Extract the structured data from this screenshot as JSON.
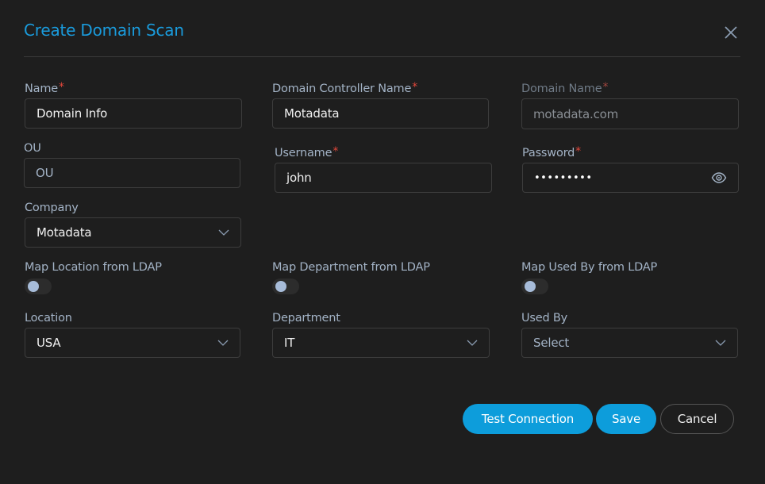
{
  "dialog": {
    "title": "Create Domain Scan",
    "close_icon": "close-icon"
  },
  "fields": {
    "name": {
      "label": "Name",
      "required": "*",
      "value": "Domain Info"
    },
    "domain_controller_name": {
      "label": "Domain Controller Name",
      "required": "*",
      "value": "Motadata"
    },
    "domain_name": {
      "label": "Domain Name",
      "required": "*",
      "value": "motadata.com",
      "disabled": true
    },
    "ou": {
      "label": "OU",
      "placeholder": "OU",
      "value": ""
    },
    "username": {
      "label": "Username",
      "required": "*",
      "value": "john"
    },
    "password": {
      "label": "Password",
      "required": "*",
      "masked_value": "•••••••••",
      "icon": "eye-icon"
    },
    "company": {
      "label": "Company",
      "selected": "Motadata"
    },
    "map_location_ldap": {
      "label": "Map Location from LDAP",
      "enabled": false
    },
    "map_department_ldap": {
      "label": "Map Department from LDAP",
      "enabled": false
    },
    "map_used_by_ldap": {
      "label": "Map Used By from LDAP",
      "enabled": false
    },
    "location": {
      "label": "Location",
      "selected": "USA"
    },
    "department": {
      "label": "Department",
      "selected": "IT"
    },
    "used_by": {
      "label": "Used By",
      "placeholder": "Select"
    }
  },
  "buttons": {
    "test_connection": "Test Connection",
    "save": "Save",
    "cancel": "Cancel"
  },
  "colors": {
    "accent": "#0d9ddb",
    "title": "#1a9bdc",
    "required": "#e2473b",
    "background": "#1e1e1e"
  }
}
